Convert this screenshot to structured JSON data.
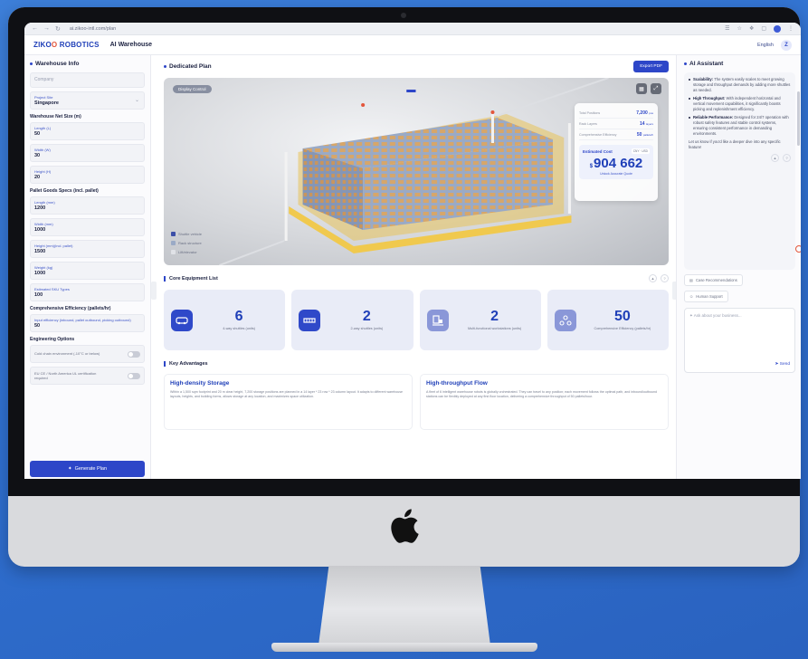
{
  "browser": {
    "url": "ai.zikoo-intl.com/plan"
  },
  "header": {
    "logo_main": "ZIKO",
    "logo_accent": "O",
    "logo_rest": "ROBOTICS",
    "app_title": "AI Warehouse",
    "language": "English",
    "avatar_letter": "Z"
  },
  "left_panel": {
    "title": "Warehouse Info",
    "company": {
      "placeholder": "Company"
    },
    "project_site": {
      "label": "Project Site",
      "value": "Singapore"
    },
    "net_size_title": "Warehouse Net Size (m)",
    "net_size": [
      {
        "label": "Length (L)",
        "value": "50"
      },
      {
        "label": "Width (W)",
        "value": "30"
      },
      {
        "label": "Height (H)",
        "value": "20"
      }
    ],
    "pallet_title": "Pallet Goods Specs (incl. pallet)",
    "pallet": [
      {
        "label": "Length (mm)",
        "value": "1200"
      },
      {
        "label": "Width (mm)",
        "value": "1000"
      },
      {
        "label": "Height (mm)(incl. pallet)",
        "value": "1500"
      },
      {
        "label": "Weight (kg)",
        "value": "1000"
      },
      {
        "label": "Estimated SKU Types",
        "value": "100"
      }
    ],
    "efficiency_title": "Comprehensive Efficiency (pallets/hr)",
    "efficiency": {
      "label": "Input efficiency (inbound, pallet outbound, picking outbound)",
      "value": "50"
    },
    "options_title": "Engineering Options",
    "options": [
      {
        "text": "Cold chain environment (-10°C or below)"
      },
      {
        "text": "EU CE / North America UL certification required"
      }
    ],
    "generate_label": "Generate Plan"
  },
  "center": {
    "title": "Dedicated Plan",
    "export_label": "Export PDF",
    "display_label": "Display Control",
    "legend": [
      "Shuttle vehicle",
      "Rack structure",
      "Lift/elevator"
    ],
    "stats": [
      {
        "k": "Total Positions",
        "v": "7,200",
        "u": "pos"
      },
      {
        "k": "Rack Layers",
        "v": "14",
        "u": "layers"
      },
      {
        "k": "Comprehensive Efficiency",
        "v": "50",
        "u": "pallets/h"
      }
    ],
    "cost": {
      "label": "Estimated Cost",
      "tag": "CNY · USD",
      "currency": "$",
      "value": "904 662",
      "note": "Unlock Accurate Quote"
    },
    "equipment_title": "Core Equipment List",
    "equipment": [
      {
        "num": "6",
        "label": "4-way shuttles (units)",
        "icon": "shuttle-icon"
      },
      {
        "num": "2",
        "label": "2-way shuttles (units)",
        "icon": "rail-shuttle-icon"
      },
      {
        "num": "2",
        "label": "Multi-functional workstations (units)",
        "icon": "workstation-icon"
      },
      {
        "num": "50",
        "label": "Comprehensive Efficiency (pallets/hr)",
        "icon": "efficiency-icon"
      }
    ],
    "advantages_title": "Key Advantages",
    "advantages": [
      {
        "title": "High-density Storage",
        "text": "Within a 1,500 sqm footprint and 20 m clear height, 7,200 storage positions are planned in a 14 layer * 23 row * 23 column layout. It adapts to different warehouse layouts, heights, and building forms, allows storage at any location, and maximizes space utilization."
      },
      {
        "title": "High-throughput Flow",
        "text": "A fleet of 6 intelligent warehouse robots is globally orchestrated. They can travel to any position; each movement follows the optimal path, and inbound/outbound stations can be flexibly deployed at any first floor location, delivering a comprehensive throughput of 50 pallets/hour."
      }
    ]
  },
  "right_panel": {
    "title": "AI Assistant",
    "messages": [
      {
        "bold": "Scalability:",
        "text": " The system easily scales to meet growing storage and throughput demands by adding more shuttles as needed."
      },
      {
        "bold": "High Throughput:",
        "text": " With independent horizontal and vertical movement capabilities, it significantly boosts picking and replenishment efficiency."
      },
      {
        "bold": "Reliable Performance:",
        "text": " Designed for 24/7 operation with robust safety features and stable control systems, ensuring consistent performance in demanding environments."
      }
    ],
    "closing": "Let us know if you'd like a deeper dive into any specific feature!",
    "quick_actions": [
      "Case Recommendations",
      "Human Support"
    ],
    "ask_placeholder": "Ask about your business...",
    "send_label": "Send"
  }
}
